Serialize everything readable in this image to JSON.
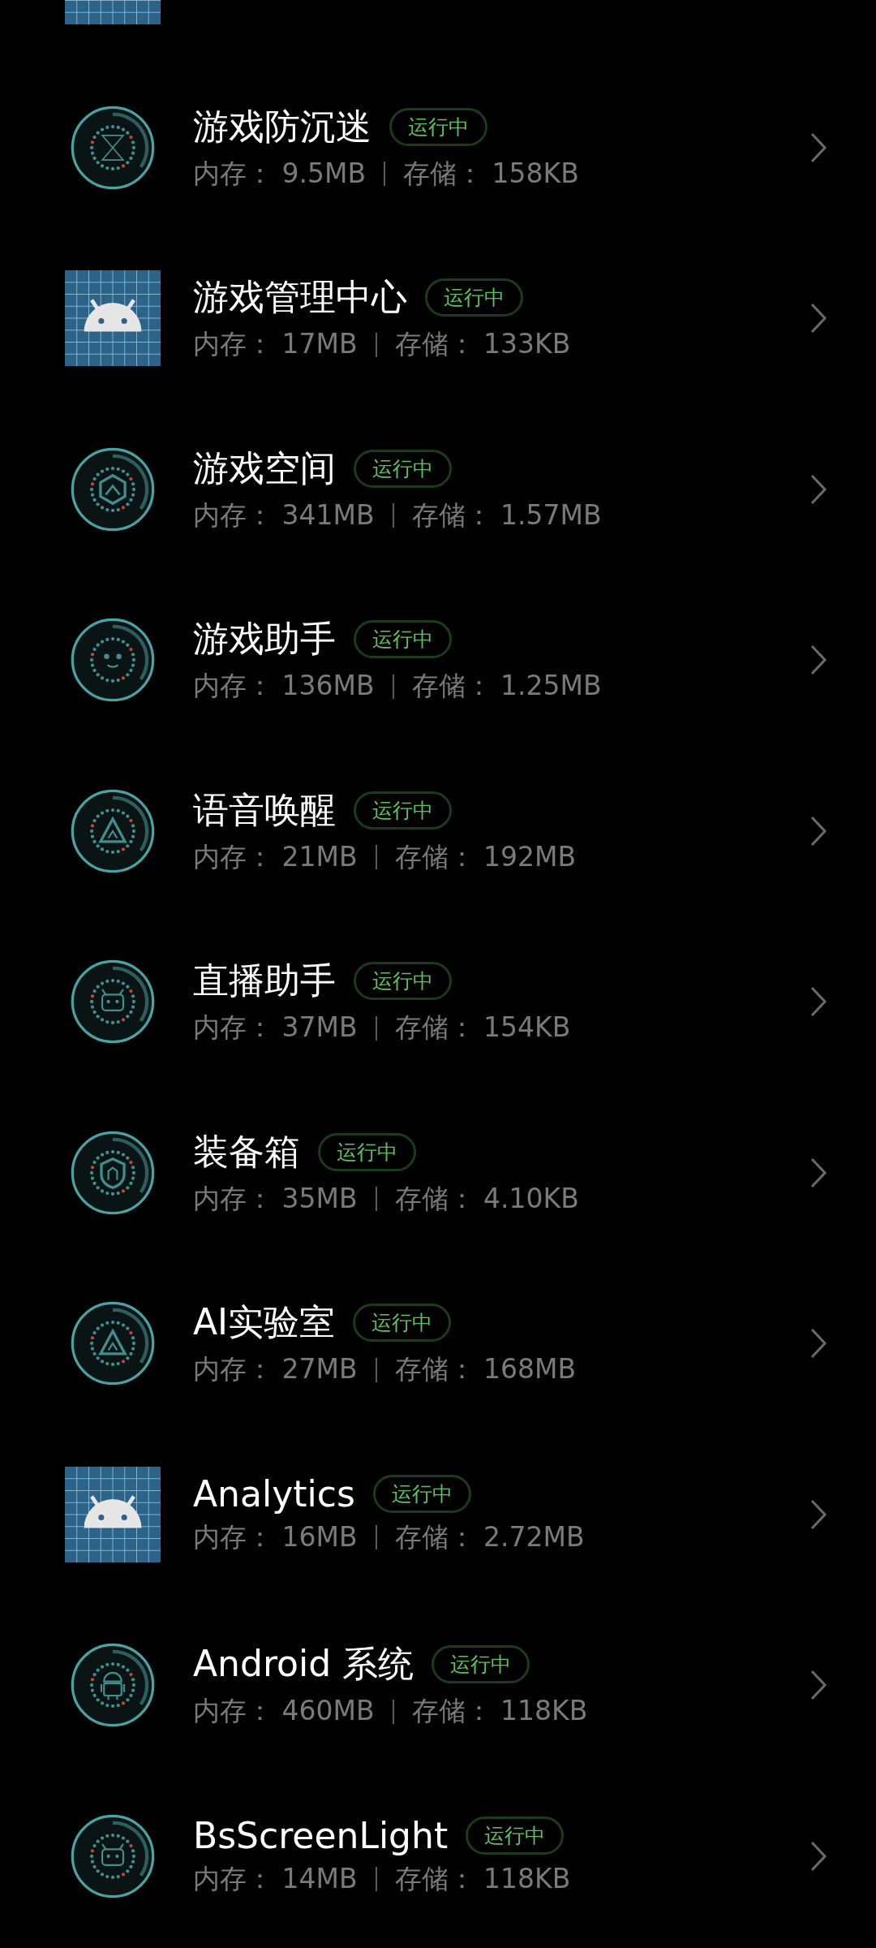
{
  "apps": [
    {
      "kind": "grid"
    },
    {
      "kind": "dial",
      "name": "游戏防沉迷",
      "status": "运行中",
      "memory_label": "内存：",
      "memory": "9.5MB",
      "storage_label": "存储：",
      "storage": "158KB"
    },
    {
      "kind": "grid",
      "name": "游戏管理中心",
      "status": "运行中",
      "memory_label": "内存：",
      "memory": "17MB",
      "storage_label": "存储：",
      "storage": "133KB"
    },
    {
      "kind": "dial",
      "name": "游戏空间",
      "status": "运行中",
      "memory_label": "内存：",
      "memory": "341MB",
      "storage_label": "存储：",
      "storage": "1.57MB"
    },
    {
      "kind": "dial",
      "name": "游戏助手",
      "status": "运行中",
      "memory_label": "内存：",
      "memory": "136MB",
      "storage_label": "存储：",
      "storage": "1.25MB"
    },
    {
      "kind": "dial",
      "name": "语音唤醒",
      "status": "运行中",
      "memory_label": "内存：",
      "memory": "21MB",
      "storage_label": "存储：",
      "storage": "192MB"
    },
    {
      "kind": "dial",
      "name": "直播助手",
      "status": "运行中",
      "memory_label": "内存：",
      "memory": "37MB",
      "storage_label": "存储：",
      "storage": "154KB"
    },
    {
      "kind": "dial",
      "name": "装备箱",
      "status": "运行中",
      "memory_label": "内存：",
      "memory": "35MB",
      "storage_label": "存储：",
      "storage": "4.10KB"
    },
    {
      "kind": "dial",
      "name": "AI实验室",
      "status": "运行中",
      "memory_label": "内存：",
      "memory": "27MB",
      "storage_label": "存储：",
      "storage": "168MB"
    },
    {
      "kind": "grid",
      "name": "Analytics",
      "status": "运行中",
      "memory_label": "内存：",
      "memory": "16MB",
      "storage_label": "存储：",
      "storage": "2.72MB"
    },
    {
      "kind": "dial",
      "name": "Android 系统",
      "status": "运行中",
      "memory_label": "内存：",
      "memory": "460MB",
      "storage_label": "存储：",
      "storage": "118KB"
    },
    {
      "kind": "dial",
      "name": "BsScreenLight",
      "status": "运行中",
      "memory_label": "内存：",
      "memory": "14MB",
      "storage_label": "存储：",
      "storage": "118KB"
    }
  ]
}
